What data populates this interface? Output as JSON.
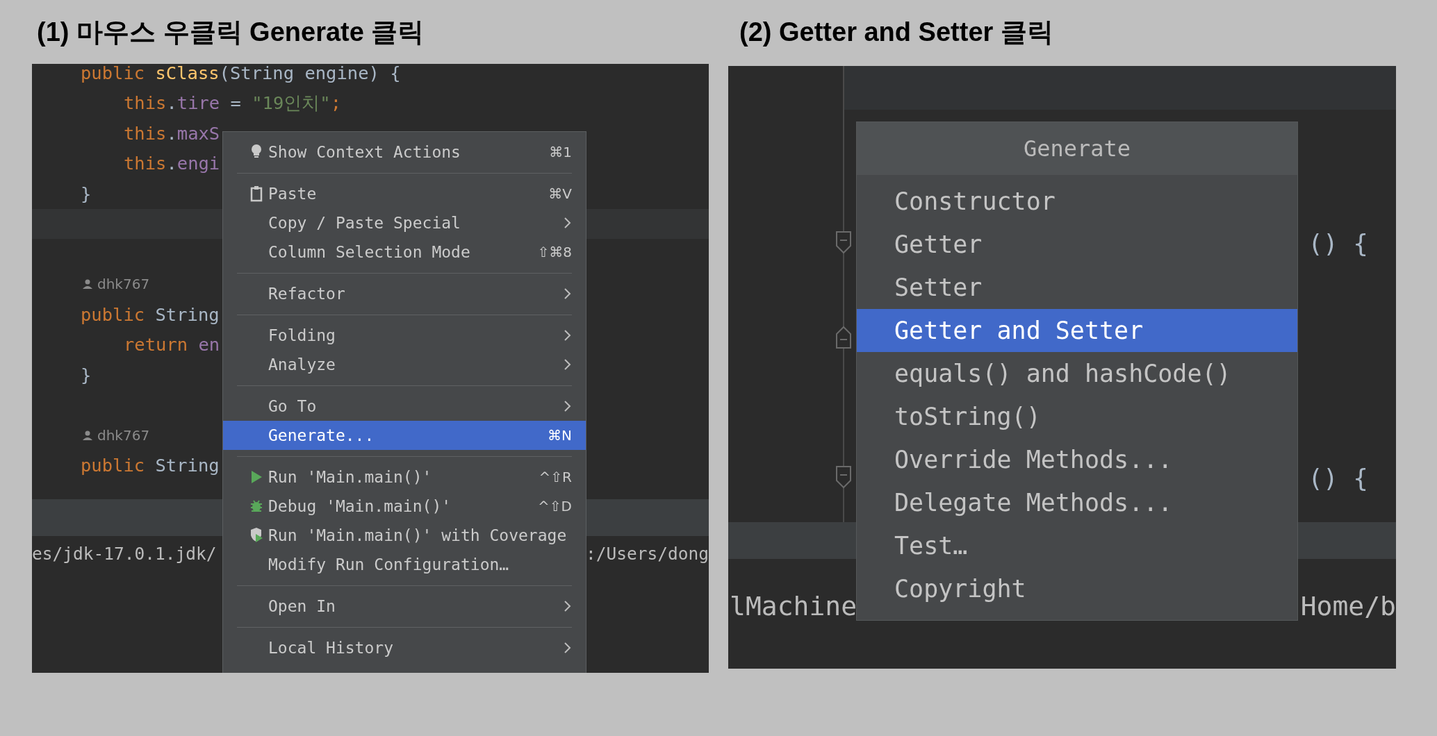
{
  "step1": {
    "caption": "(1) 마우스 우클릭 Generate 클릭",
    "editor_lines": [
      {
        "kind": "code",
        "tokens": [
          {
            "text": "public ",
            "kind": "keyword"
          },
          {
            "text": "sClass",
            "kind": "method"
          },
          {
            "text": "(String engine) {",
            "kind": "plain"
          }
        ],
        "children": [
          {
            "kind": "code",
            "tokens": [
              {
                "text": "this",
                "kind": "keyword"
              },
              {
                "text": ".",
                "kind": "plain"
              },
              {
                "text": "tire",
                "kind": "field"
              },
              {
                "text": " = ",
                "kind": "plain"
              },
              {
                "text": "\"19인치\"",
                "kind": "string"
              },
              {
                "text": ";",
                "kind": "keyword"
              }
            ]
          },
          {
            "kind": "code",
            "tokens": [
              {
                "text": "this",
                "kind": "keyword"
              },
              {
                "text": ".",
                "kind": "plain"
              },
              {
                "text": "maxS",
                "kind": "field"
              }
            ]
          },
          {
            "kind": "code",
            "tokens": [
              {
                "text": "this",
                "kind": "keyword"
              },
              {
                "text": ".",
                "kind": "plain"
              },
              {
                "text": "engi",
                "kind": "field"
              }
            ]
          }
        ]
      },
      {
        "kind": "code",
        "tokens": [
          {
            "text": "}",
            "kind": "plain"
          }
        ]
      },
      {
        "kind": "current-line"
      },
      {
        "kind": "blank"
      },
      {
        "kind": "author",
        "text": "dhk767"
      },
      {
        "kind": "code",
        "tokens": [
          {
            "text": "public ",
            "kind": "keyword"
          },
          {
            "text": "String",
            "kind": "plain"
          }
        ],
        "children": [
          {
            "kind": "code",
            "tokens": [
              {
                "text": "return ",
                "kind": "keyword"
              },
              {
                "text": "en",
                "kind": "field"
              }
            ]
          }
        ]
      },
      {
        "kind": "code",
        "tokens": [
          {
            "text": "}",
            "kind": "plain"
          }
        ]
      },
      {
        "kind": "blank"
      },
      {
        "kind": "author",
        "text": "dhk767"
      },
      {
        "kind": "code",
        "tokens": [
          {
            "text": "public ",
            "kind": "keyword"
          },
          {
            "text": "String",
            "kind": "plain"
          }
        ]
      }
    ],
    "console": [
      "es/jdk-17.0.1.jdk/",
      ":/Users/dong"
    ],
    "menu": [
      {
        "kind": "hint",
        "label": "Show Context Actions",
        "shortcut": "⌘1",
        "submenu": false,
        "selected": false
      },
      {
        "kind": "separator"
      },
      {
        "kind": "paste",
        "label": "Paste",
        "shortcut": "⌘V",
        "submenu": false,
        "selected": false
      },
      {
        "kind": "plain",
        "label": "Copy / Paste Special",
        "submenu": true,
        "selected": false
      },
      {
        "kind": "plain",
        "label": "Column Selection Mode",
        "shortcut": "⇧⌘8",
        "submenu": false,
        "selected": false
      },
      {
        "kind": "separator"
      },
      {
        "kind": "plain",
        "label": "Refactor",
        "submenu": true,
        "selected": false
      },
      {
        "kind": "separator"
      },
      {
        "kind": "plain",
        "label": "Folding",
        "submenu": true,
        "selected": false
      },
      {
        "kind": "plain",
        "label": "Analyze",
        "submenu": true,
        "selected": false
      },
      {
        "kind": "separator"
      },
      {
        "kind": "plain",
        "label": "Go To",
        "submenu": true,
        "selected": false
      },
      {
        "kind": "plain",
        "label": "Generate...",
        "shortcut": "⌘N",
        "submenu": false,
        "selected": true
      },
      {
        "kind": "separator"
      },
      {
        "kind": "run",
        "label": "Run 'Main.main()'",
        "shortcut": "^⇧R",
        "submenu": false,
        "selected": false
      },
      {
        "kind": "debug",
        "label": "Debug 'Main.main()'",
        "shortcut": "^⇧D",
        "submenu": false,
        "selected": false
      },
      {
        "kind": "coverage",
        "label": "Run 'Main.main()' with Coverage",
        "submenu": false,
        "selected": false
      },
      {
        "kind": "plain",
        "label": "Modify Run Configuration…",
        "submenu": false,
        "selected": false
      },
      {
        "kind": "separator"
      },
      {
        "kind": "plain",
        "label": "Open In",
        "submenu": true,
        "selected": false
      },
      {
        "kind": "separator"
      },
      {
        "kind": "plain",
        "label": "Local History",
        "submenu": true,
        "selected": false
      }
    ]
  },
  "step2": {
    "caption": "(2) Getter and Setter 클릭",
    "gutter_markers": [
      {
        "kind": "fold-start"
      },
      {
        "kind": "fold-end"
      },
      {
        "kind": "fold-start"
      }
    ],
    "code_fragments": [
      "() {",
      "() {"
    ],
    "console": [
      "lMachine",
      "Home/b"
    ],
    "popup": {
      "title": "Generate",
      "items": [
        {
          "label": "Constructor",
          "selected": false
        },
        {
          "label": "Getter",
          "selected": false
        },
        {
          "label": "Setter",
          "selected": false
        },
        {
          "label": "Getter and Setter",
          "selected": true
        },
        {
          "label": "equals() and hashCode()",
          "selected": false
        },
        {
          "label": "toString()",
          "selected": false
        },
        {
          "label": "Override Methods...",
          "selected": false
        },
        {
          "label": "Delegate Methods...",
          "selected": false
        },
        {
          "label": "Test…",
          "selected": false
        },
        {
          "label": "Copyright",
          "selected": false
        }
      ]
    }
  }
}
